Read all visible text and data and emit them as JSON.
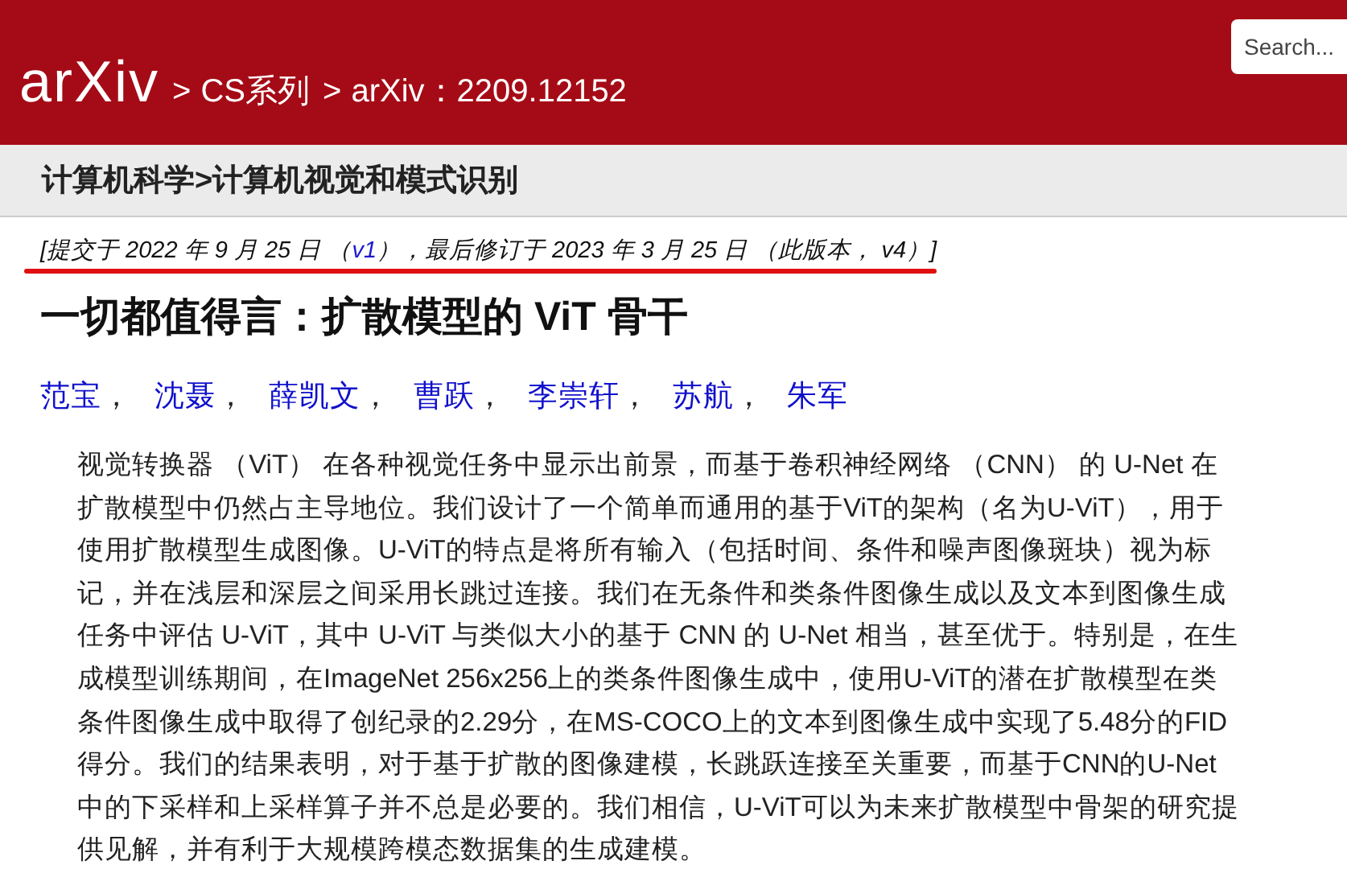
{
  "header": {
    "logo": "arXiv",
    "breadcrumb": [
      {
        "separator": ">",
        "label": "CS系列"
      },
      {
        "separator": ">",
        "label": "arXiv：2209.12152"
      }
    ],
    "search": {
      "placeholder": "Search..."
    }
  },
  "subject_bar": {
    "text": "计算机科学>计算机视觉和模式识别"
  },
  "submission": {
    "before": "[提交于 2022 年 9 月 25 日 （",
    "link": "v1",
    "after": "），最后修订于 2023 年 3 月 25 日 （此版本， v4）]",
    "underlined": true
  },
  "title": "一切都值得言：扩散模型的 ViT 骨干",
  "authors": [
    {
      "name": "范宝",
      "separator": "，"
    },
    {
      "name": "沈聂",
      "separator": "，"
    },
    {
      "name": "薛凯文",
      "separator": "，"
    },
    {
      "name": "曹跃",
      "separator": "，"
    },
    {
      "name": "李崇轩",
      "separator": "，"
    },
    {
      "name": "苏航",
      "separator": "，"
    },
    {
      "name": "朱军"
    }
  ],
  "abstract": "视觉转换器 （ViT） 在各种视觉任务中显示出前景，而基于卷积神经网络 （CNN） 的 U-Net 在扩散模型中仍然占主导地位。我们设计了一个简单而通用的基于ViT的架构（名为U-ViT），用于使用扩散模型生成图像。U-ViT的特点是将所有输入（包括时间、条件和噪声图像斑块）视为标记，并在浅层和深层之间采用长跳过连接。我们在无条件和类条件图像生成以及文本到图像生成任务中评估 U-ViT，其中 U-ViT 与类似大小的基于 CNN 的 U-Net 相当，甚至优于。特别是，在生成模型训练期间，在ImageNet 256x256上的类条件图像生成中，使用U-ViT的潜在扩散模型在类条件图像生成中取得了创纪录的2.29分，在MS-COCO上的文本到图像生成中实现了5.48分的FID得分。我们的结果表明，对于基于扩散的图像建模，长跳跃连接至关重要，而基于CNN的U-Net中的下采样和上采样算子并不总是必要的。我们相信，U-ViT可以为未来扩散模型中骨架的研究提供见解，并有利于大规模跨模态数据集的生成建模。"
}
